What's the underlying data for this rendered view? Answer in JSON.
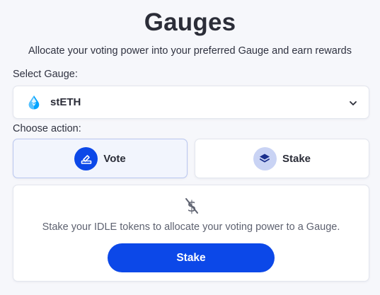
{
  "header": {
    "title": "Gauges",
    "subtitle": "Allocate your voting power into your preferred Gauge and earn rewards"
  },
  "gauge_select": {
    "label": "Select Gauge:",
    "selected": "stETH",
    "selected_icon": "steth-drop-icon",
    "dropdown_icon": "chevron-down-icon"
  },
  "actions": {
    "label": "Choose action:",
    "selected": "Vote",
    "items": [
      {
        "label": "Vote",
        "icon": "vote-ballot-icon",
        "active": true
      },
      {
        "label": "Stake",
        "icon": "layers-icon",
        "active": false
      }
    ]
  },
  "stake_panel": {
    "icon": "dollar-slash-icon",
    "message": "Stake your IDLE tokens to allocate your voting power to a Gauge.",
    "button_label": "Stake"
  },
  "colors": {
    "accent": "#0c48e8",
    "accent_light": "#c9d3f4",
    "background": "#f6f7fb",
    "steth_blue": "#00a3ff"
  }
}
